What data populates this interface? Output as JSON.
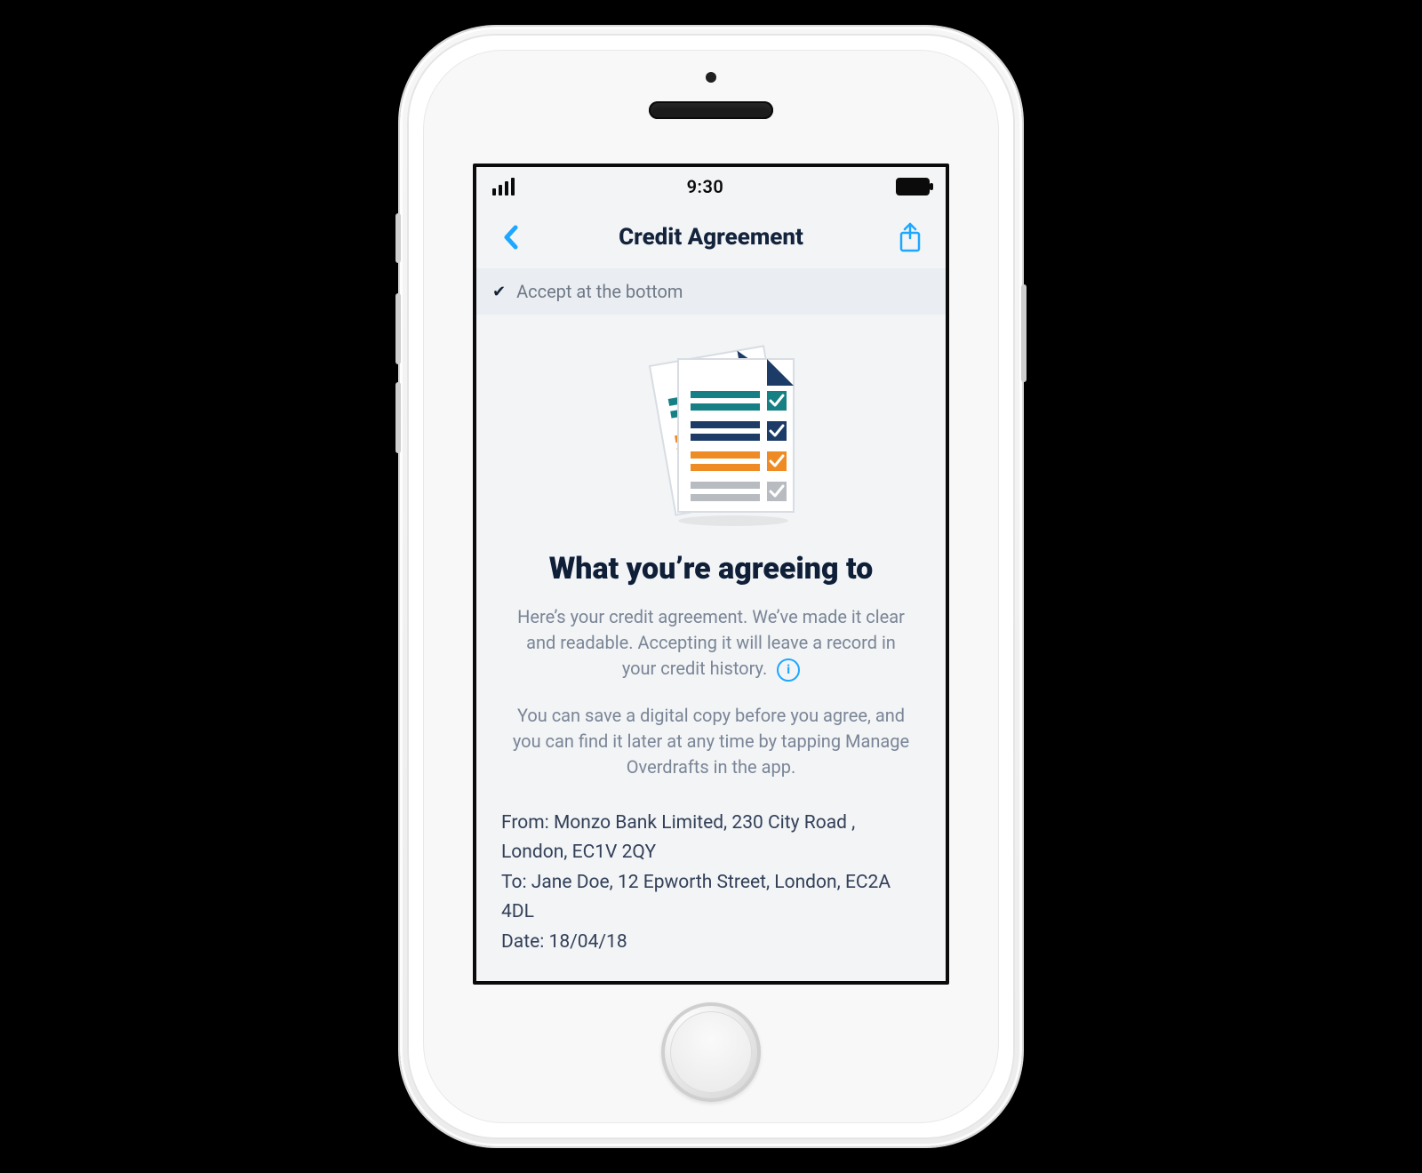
{
  "statusbar": {
    "time": "9:30"
  },
  "nav": {
    "title": "Credit Agreement"
  },
  "banner": {
    "text": "Accept at the bottom"
  },
  "heading": "What you’re agreeing to",
  "intro": {
    "p1": "Here’s your credit agreement. We’ve made it clear and readable. Accepting it will leave a record in your credit history.",
    "p2": "You can save a digital copy before you agree, and you can find it later at any time by tapping Manage Overdrafts in the app."
  },
  "details": {
    "from_label": "From:",
    "from_value": "Monzo Bank Limited, 230 City Road , London, EC1V 2QY",
    "to_label": "To:",
    "to_value": "Jane Doe, 12 Epworth Street, London, EC2A 4DL",
    "date_label": "Date:",
    "date_value": "18/04/18"
  },
  "icons": {
    "back": "chevron-left",
    "share": "share",
    "info": "info",
    "documents": "documents-checklist"
  }
}
